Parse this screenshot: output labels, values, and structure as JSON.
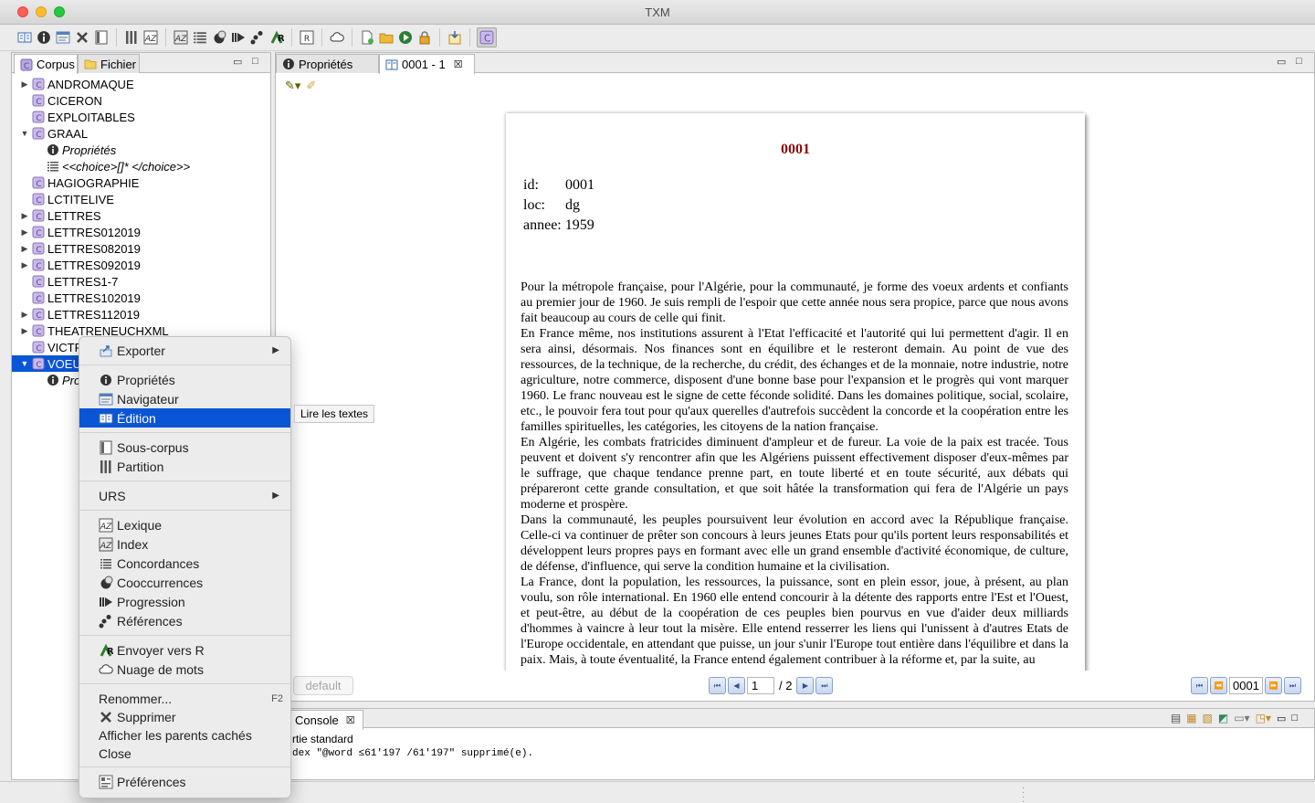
{
  "window": {
    "title": "TXM"
  },
  "toolbar": {
    "icons": [
      "edition-book-icon",
      "info-icon",
      "navigator-icon",
      "delete-x-icon",
      "subcorpus-icon",
      "partition-icon",
      "lexicon-az-icon",
      "index-az-icon",
      "concordance-icon",
      "cooccurrence-icon",
      "progression-icon",
      "references-icon",
      "r-send-icon",
      "r-package-icon",
      "cloud-icon",
      "new-file-icon",
      "open-folder-icon",
      "run-icon",
      "lock-icon",
      "import-icon",
      "txm-perspective-icon"
    ]
  },
  "left_panel": {
    "tabs": [
      {
        "label": "Corpus"
      },
      {
        "label": "Fichier"
      }
    ],
    "tree": [
      {
        "label": "ANDROMAQUE",
        "twisty": "▶",
        "indent": 0
      },
      {
        "label": "CICERON",
        "twisty": "",
        "indent": 0
      },
      {
        "label": "EXPLOITABLES",
        "twisty": "",
        "indent": 0
      },
      {
        "label": "GRAAL",
        "twisty": "▼",
        "indent": 0
      },
      {
        "label": "Propriétés",
        "twisty": "",
        "indent": 1,
        "italic": true,
        "icon": "info"
      },
      {
        "label": "<<choice>[]* </choice>>",
        "twisty": "",
        "indent": 1,
        "italic": true,
        "icon": "conc"
      },
      {
        "label": "HAGIOGRAPHIE",
        "twisty": "",
        "indent": 0
      },
      {
        "label": "LCTITELIVE",
        "twisty": "",
        "indent": 0
      },
      {
        "label": "LETTRES",
        "twisty": "▶",
        "indent": 0
      },
      {
        "label": "LETTRES012019",
        "twisty": "▶",
        "indent": 0
      },
      {
        "label": "LETTRES082019",
        "twisty": "▶",
        "indent": 0
      },
      {
        "label": "LETTRES092019",
        "twisty": "▶",
        "indent": 0
      },
      {
        "label": "LETTRES1-7",
        "twisty": "",
        "indent": 0
      },
      {
        "label": "LETTRES102019",
        "twisty": "",
        "indent": 0
      },
      {
        "label": "LETTRES112019",
        "twisty": "▶",
        "indent": 0
      },
      {
        "label": "THEATRENEUCHXML",
        "twisty": "▶",
        "indent": 0
      },
      {
        "label": "VICTR",
        "twisty": "",
        "indent": 0
      },
      {
        "label": "VOEU",
        "twisty": "▼",
        "indent": 0,
        "selected": true
      },
      {
        "label": "Pro",
        "twisty": "",
        "indent": 1,
        "italic": true,
        "icon": "info"
      }
    ]
  },
  "editor": {
    "tabs": [
      {
        "label": "Propriétés"
      },
      {
        "label": "0001 - 1"
      }
    ],
    "page": {
      "title": "0001",
      "meta": [
        {
          "key": "id:",
          "value": "0001"
        },
        {
          "key": "loc:",
          "value": "dg"
        },
        {
          "key": "annee:",
          "value": "1959"
        }
      ],
      "paragraphs": [
        "Pour la métropole française, pour l'Algérie, pour la communauté, je forme des voeux ardents et confiants au premier jour de 1960. Je suis rempli de l'espoir que cette année nous sera propice, parce que nous avons fait beaucoup au cours de celle qui finit.",
        "En France même, nos institutions assurent à l'Etat l'efficacité et l'autorité qui lui permettent d'agir. Il en sera ainsi, désormais. Nos finances sont en équilibre et le resteront demain. Au point de vue des ressources, de la technique, de la recherche, du crédit, des échanges et de la monnaie, notre industrie, notre agriculture, notre commerce, disposent d'une bonne base pour l'expansion et le progrès qui vont marquer 1960. Le franc nouveau est le signe de cette féconde solidité. Dans les domaines politique, social, scolaire, etc., le pouvoir fera tout pour qu'aux querelles d'autrefois succèdent la concorde et la coopération entre les familles spirituelles, les catégories, les citoyens de la nation française.",
        "En Algérie, les combats fratricides diminuent d'ampleur et de fureur. La voie de la paix est tracée. Tous peuvent et doivent s'y rencontrer afin que les Algériens puissent effectivement disposer d'eux-mêmes par le suffrage, que chaque tendance prenne part, en toute liberté et en toute sécurité, aux débats qui prépareront cette grande consultation, et que soit hâtée la transformation qui fera de l'Algérie un pays moderne et prospère.",
        "Dans la communauté, les peuples poursuivent leur évolution en accord avec la République française. Celle-ci va continuer de prêter son concours à leurs jeunes Etats pour qu'ils portent leurs responsabilités et développent leurs propres pays en formant avec elle un grand ensemble d'activité économique, de culture, de défense, d'influence, qui serve la condition humaine et la civilisation.",
        "La France, dont la population, les ressources, la puissance, sont en plein essor, joue, à présent, au plan voulu, son rôle international. En 1960 elle entend concourir à la détente des rapports entre l'Est et l'Ouest, et peut-être, au début de la coopération de ces peuples bien pourvus en vue d'aider deux milliards d'hommes à vaincre à leur tout la misère. Elle entend resserrer les liens qui l'unissent à d'autres Etats de l'Europe occidentale, en attendant que puisse, un jour s'unir l'Europe tout entière dans l'équilibre et dans la paix. Mais, à toute éventualité, la France entend également contribuer à la réforme et, par la suite, au"
      ]
    },
    "footer": {
      "default_label": "default",
      "page_value": "1",
      "page_total": "/ 2",
      "text_id": "0001"
    }
  },
  "console": {
    "tab_label": "Console",
    "line1": "rtie standard",
    "line2": "dex \"@word ≤61'197 /61'197\" supprimé(e)."
  },
  "context_menu": {
    "items": [
      {
        "label": "Exporter",
        "icon": "export",
        "submenu": true
      },
      {
        "sep": true
      },
      {
        "label": "Propriétés",
        "icon": "info"
      },
      {
        "label": "Navigateur",
        "icon": "navigator"
      },
      {
        "label": "Édition",
        "icon": "book",
        "highlighted": true
      },
      {
        "sep": true
      },
      {
        "label": "Sous-corpus",
        "icon": "subcorpus"
      },
      {
        "label": "Partition",
        "icon": "partition"
      },
      {
        "sep": true
      },
      {
        "label": "URS",
        "submenu": true
      },
      {
        "sep": true
      },
      {
        "label": "Lexique",
        "icon": "lexicon"
      },
      {
        "label": "Index",
        "icon": "index"
      },
      {
        "label": "Concordances",
        "icon": "conc"
      },
      {
        "label": "Cooccurrences",
        "icon": "cooc"
      },
      {
        "label": "Progression",
        "icon": "progression"
      },
      {
        "label": "Références",
        "icon": "references"
      },
      {
        "sep": true
      },
      {
        "label": "Envoyer vers R",
        "icon": "r"
      },
      {
        "label": "Nuage de mots",
        "icon": "cloud"
      },
      {
        "sep": true
      },
      {
        "label": "Renommer...",
        "shortcut": "F2"
      },
      {
        "label": "Supprimer",
        "icon": "delete"
      },
      {
        "label": "Afficher les parents cachés"
      },
      {
        "label": "Close"
      },
      {
        "sep": true
      },
      {
        "label": "Préférences",
        "icon": "prefs"
      }
    ],
    "tooltip": "Lire les textes"
  },
  "colors": {
    "selection": "#0a55d6",
    "page_title": "#8b0d0d",
    "corpus_icon": "#8a6fc0"
  }
}
